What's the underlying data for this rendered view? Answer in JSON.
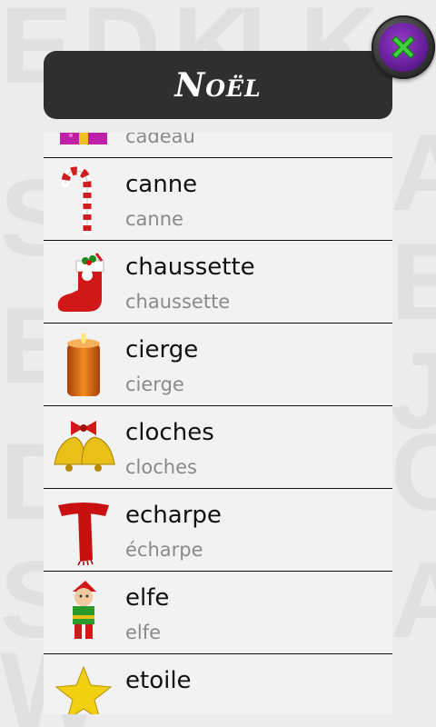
{
  "header": {
    "title": "Noël"
  },
  "close_button": {
    "icon": "close-x-icon"
  },
  "items": [
    {
      "word": "cadeau",
      "translation": "cadeau",
      "icon": "gift-icon"
    },
    {
      "word": "canne",
      "translation": "canne",
      "icon": "candy-cane-icon"
    },
    {
      "word": "chaussette",
      "translation": "chaussette",
      "icon": "stocking-icon"
    },
    {
      "word": "cierge",
      "translation": "cierge",
      "icon": "candle-icon"
    },
    {
      "word": "cloches",
      "translation": "cloches",
      "icon": "bells-icon"
    },
    {
      "word": "echarpe",
      "translation": "écharpe",
      "icon": "scarf-icon"
    },
    {
      "word": "elfe",
      "translation": "elfe",
      "icon": "elf-icon"
    },
    {
      "word": "etoile",
      "translation": "",
      "icon": "star-icon"
    }
  ]
}
